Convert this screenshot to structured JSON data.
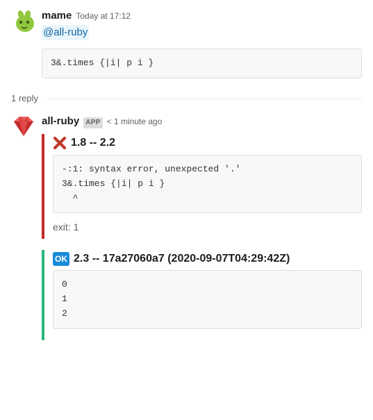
{
  "message1": {
    "author": "mame",
    "timestamp": "Today at 17:12",
    "mention": "@all-ruby",
    "code": "3&.times {|i| p i }"
  },
  "thread_label": "1 reply",
  "message2": {
    "author": "all-ruby",
    "app_badge": "APP",
    "timestamp": "< 1 minute ago",
    "attachment_fail": {
      "title": "1.8 -- 2.2",
      "code": "-:1: syntax error, unexpected '.'\n3&.times {|i| p i }\n  ^",
      "exit": "exit: 1"
    },
    "attachment_ok": {
      "badge": "OK",
      "title": "2.3 -- 17a27060a7 (2020-09-07T04:29:42Z)",
      "code": "0\n1\n2"
    }
  }
}
